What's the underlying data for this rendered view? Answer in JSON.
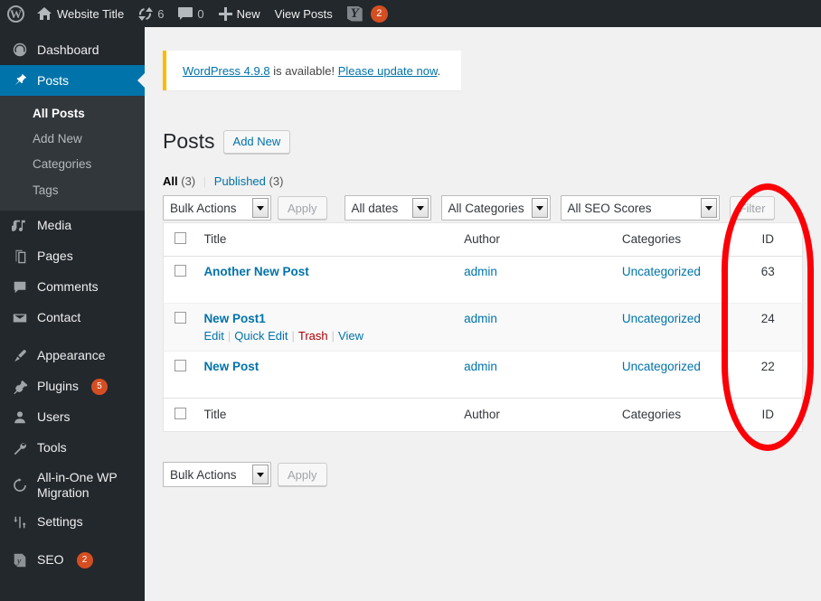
{
  "adminbar": {
    "logo_icon": "wordpress-logo-icon",
    "site": {
      "icon": "home-icon",
      "label": "Website Title"
    },
    "updates": {
      "icon": "updates-icon",
      "count": "6"
    },
    "comments": {
      "icon": "comment-bubble-icon",
      "count": "0"
    },
    "new": {
      "icon": "plus-icon",
      "label": "New"
    },
    "view_posts": {
      "label": "View Posts"
    },
    "yoast": {
      "icon": "yoast-seo-icon",
      "badge": "2"
    }
  },
  "sidebar": {
    "items": [
      {
        "label": "Dashboard",
        "icon": "dashboard-icon",
        "badge": null,
        "active": false
      },
      {
        "label": "Posts",
        "icon": "pin-icon",
        "badge": null,
        "active": true
      },
      {
        "label": "Media",
        "icon": "media-icon",
        "badge": null,
        "active": false
      },
      {
        "label": "Pages",
        "icon": "pages-icon",
        "badge": null,
        "active": false
      },
      {
        "label": "Comments",
        "icon": "comment-bubble-icon",
        "badge": null,
        "active": false
      },
      {
        "label": "Contact",
        "icon": "envelope-icon",
        "badge": null,
        "active": false
      },
      {
        "label": "Appearance",
        "icon": "paintbrush-icon",
        "badge": null,
        "active": false
      },
      {
        "label": "Plugins",
        "icon": "plug-icon",
        "badge": "5",
        "active": false
      },
      {
        "label": "Users",
        "icon": "user-icon",
        "badge": null,
        "active": false
      },
      {
        "label": "Tools",
        "icon": "wrench-icon",
        "badge": null,
        "active": false
      },
      {
        "label": "All-in-One WP Migration",
        "icon": "migration-icon",
        "badge": null,
        "active": false
      },
      {
        "label": "Settings",
        "icon": "settings-sliders-icon",
        "badge": null,
        "active": false
      },
      {
        "label": "SEO",
        "icon": "yoast-seo-icon",
        "badge": "2",
        "active": false
      }
    ],
    "submenu": [
      {
        "label": "All Posts",
        "current": true
      },
      {
        "label": "Add New",
        "current": false
      },
      {
        "label": "Categories",
        "current": false
      },
      {
        "label": "Tags",
        "current": false
      }
    ]
  },
  "notice": {
    "version_link": "WordPress 4.9.8",
    "middle": " is available! ",
    "update_link": "Please update now",
    "period": ".",
    "accent_color": "#ffb900"
  },
  "page": {
    "title": "Posts",
    "add_new_label": "Add New"
  },
  "views": {
    "all_label": "All",
    "all_count": "(3)",
    "separator": "|",
    "published_label": "Published",
    "published_count": "(3)"
  },
  "tablenav_top": {
    "bulk_actions": "Bulk Actions",
    "apply_label": "Apply",
    "dates": "All dates",
    "categories": "All Categories",
    "seo_scores": "All SEO Scores",
    "filter_label": "Filter"
  },
  "tablenav_bottom": {
    "bulk_actions": "Bulk Actions",
    "apply_label": "Apply"
  },
  "table": {
    "columns": [
      "Title",
      "Author",
      "Categories",
      "ID"
    ],
    "rows": [
      {
        "title": "Another New Post",
        "author": "admin",
        "categories": "Uncategorized",
        "id": "63",
        "actions": []
      },
      {
        "title": "New Post1",
        "author": "admin",
        "categories": "Uncategorized",
        "id": "24",
        "actions": [
          "Edit",
          "Quick Edit",
          "Trash",
          "View"
        ]
      },
      {
        "title": "New Post",
        "author": "admin",
        "categories": "Uncategorized",
        "id": "22",
        "actions": []
      }
    ]
  },
  "annotation": {
    "shape": "ellipse",
    "color": "#fb0007",
    "target": "ID column"
  }
}
